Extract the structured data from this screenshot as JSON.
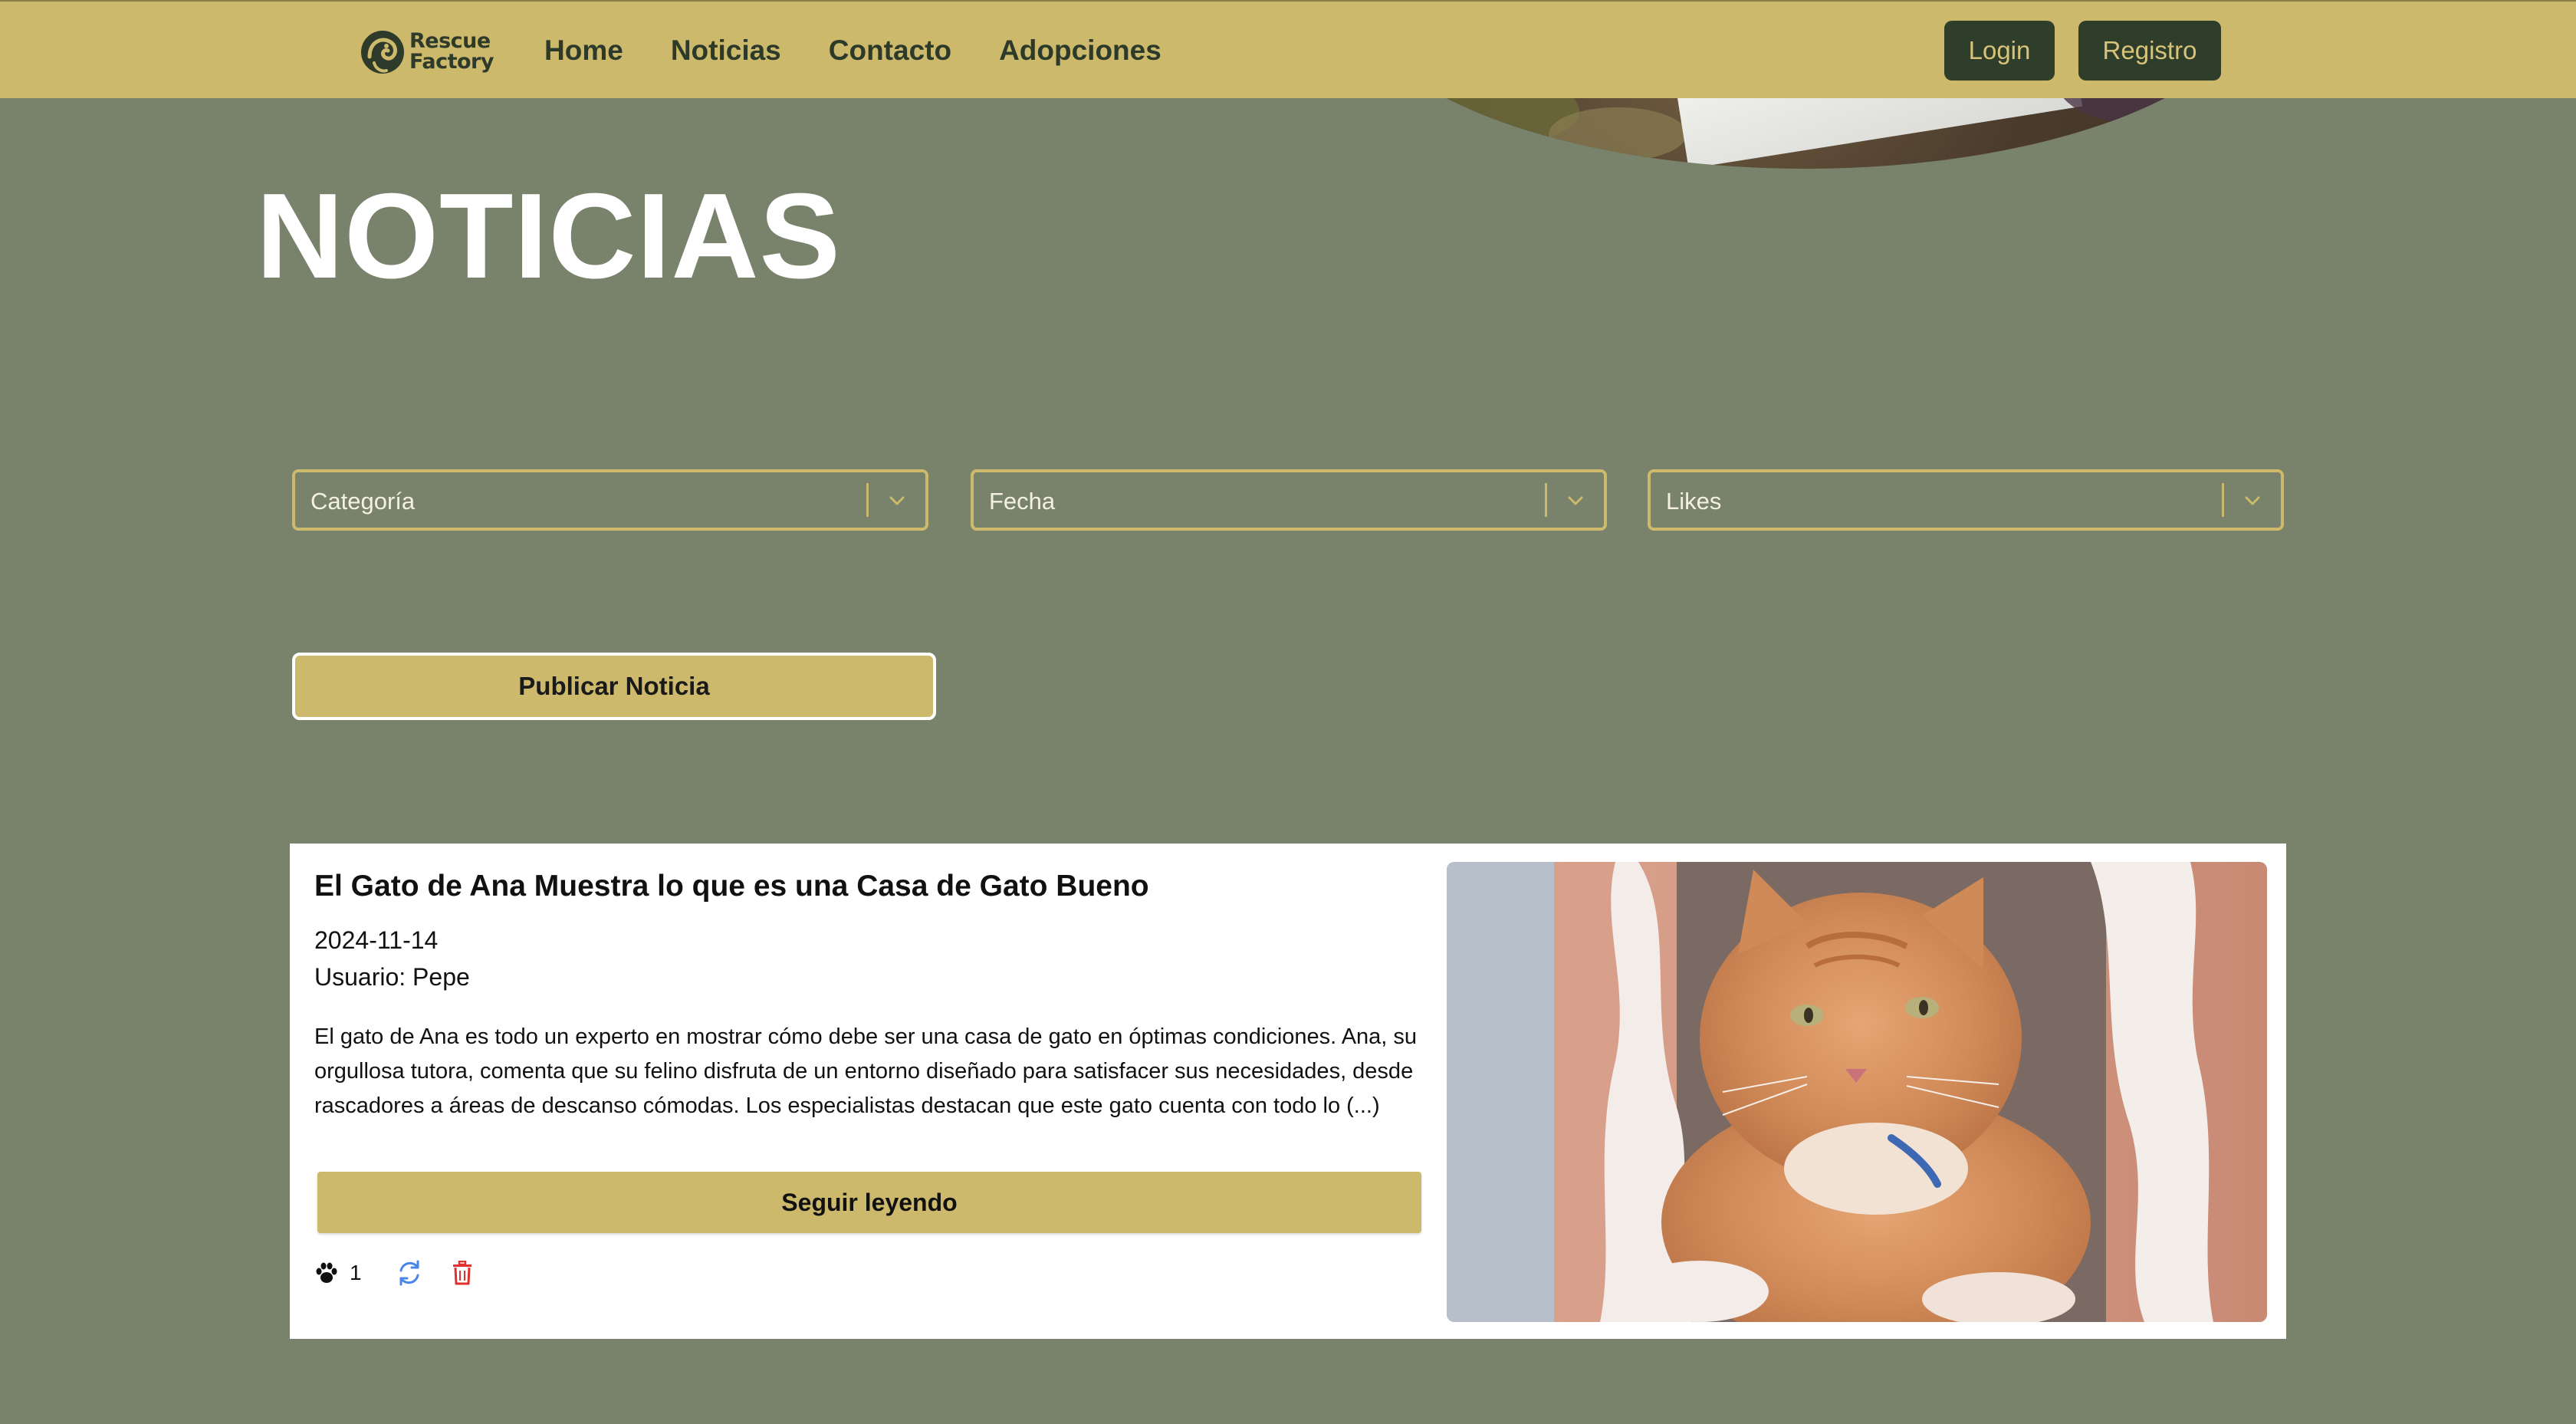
{
  "brand": {
    "line1": "Rescue",
    "line2": "Factory"
  },
  "nav": {
    "links": [
      "Home",
      "Noticias",
      "Contacto",
      "Adopciones"
    ],
    "login_label": "Login",
    "registro_label": "Registro"
  },
  "page": {
    "title": "NOTICIAS"
  },
  "filters": {
    "categoria": "Categoría",
    "fecha": "Fecha",
    "likes": "Likes"
  },
  "publish_label": "Publicar Noticia",
  "news": [
    {
      "title": "El Gato de Ana Muestra lo que es una Casa de Gato Bueno",
      "date": "2024-11-14",
      "user": "Usuario: Pepe",
      "excerpt": "El gato de Ana es todo un experto en mostrar cómo debe ser una casa de gato en óptimas condiciones. Ana, su orgullosa tutora, comenta que su felino disfruta de un entorno diseñado para satisfacer sus necesidades, desde rascadores a áreas de descanso cómodas. Los especialistas destacan que este gato cuenta con todo lo (...)",
      "read_more_label": "Seguir leyendo",
      "likes": "1"
    }
  ],
  "colors": {
    "background": "#79836c",
    "navbar": "#cdb96b",
    "dark_button": "#2f3d2b",
    "accent": "#cdb96b",
    "refresh_icon": "#4a86e8",
    "delete_icon": "#e03131"
  },
  "icons": [
    "paw-icon",
    "refresh-icon",
    "trash-icon",
    "chevron-down-icon"
  ]
}
